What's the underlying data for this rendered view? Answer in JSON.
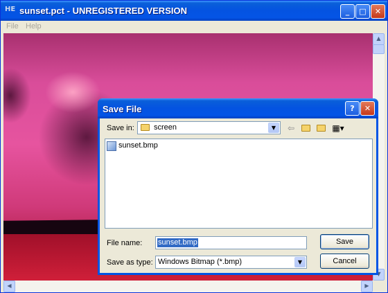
{
  "window": {
    "title": "sunset.pct - UNREGISTERED VERSION",
    "app_icon": "HE",
    "controls": {
      "minimize": "_",
      "maximize": "□",
      "close": "✕"
    }
  },
  "menubar": {
    "items": [
      {
        "label": "File"
      },
      {
        "label": "Help"
      }
    ]
  },
  "dialog": {
    "title": "Save File",
    "help_button": "?",
    "close_button": "✕",
    "save_in_label": "Save in:",
    "save_in_value": "screen",
    "files": [
      {
        "name": "sunset.bmp"
      }
    ],
    "file_name_label": "File name:",
    "file_name_value": "sunset.bmp",
    "save_as_type_label": "Save as type:",
    "save_as_type_value": "Windows Bitmap (*.bmp)",
    "save_button": "Save",
    "cancel_button": "Cancel"
  },
  "icons": {
    "back": "back-arrow-icon",
    "up": "up-folder-icon",
    "new_folder": "new-folder-icon",
    "view": "view-menu-icon"
  },
  "colors": {
    "titlebar": "#0454e6",
    "selection": "#316ac5"
  }
}
